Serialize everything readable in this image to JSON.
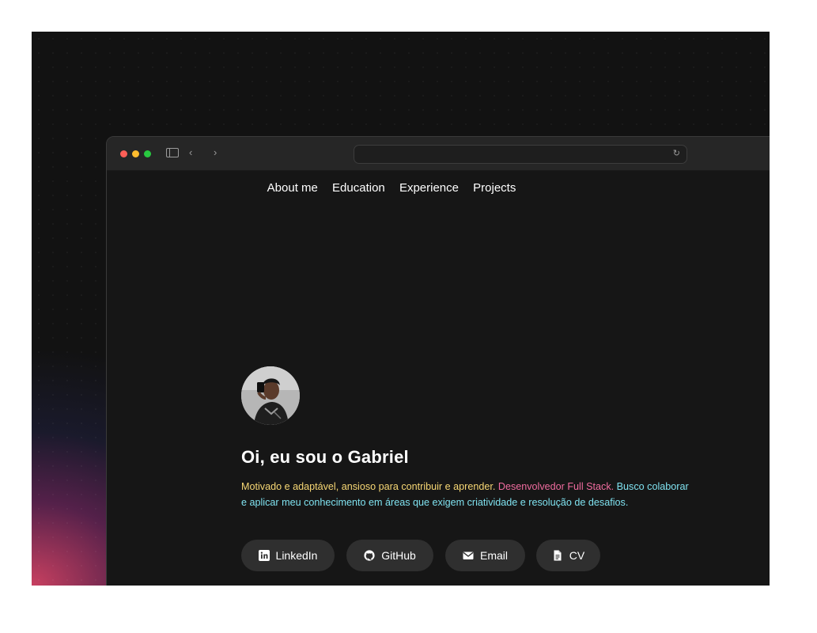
{
  "nav": {
    "items": [
      "About me",
      "Education",
      "Experience",
      "Projects"
    ]
  },
  "hero": {
    "heading": "Oi, eu sou o Gabriel",
    "bio": {
      "part1": "Motivado e adaptável, ansioso para contribuir e aprender.",
      "part2": "Desenvolvedor Full Stack.",
      "part3": "Busco colaborar e aplicar meu conhecimento em áreas que exigem criatividade e resolução de desafios."
    }
  },
  "buttons": {
    "linkedin": {
      "label": "LinkedIn",
      "icon": "linkedin-icon"
    },
    "github": {
      "label": "GitHub",
      "icon": "github-icon"
    },
    "email": {
      "label": "Email",
      "icon": "mail-icon"
    },
    "cv": {
      "label": "CV",
      "icon": "document-icon"
    }
  },
  "colors": {
    "bio_primary": "#f7d774",
    "bio_highlight": "#f06c9f",
    "bio_secondary": "#7fe1ef",
    "button_bg": "#2f2f2f"
  }
}
